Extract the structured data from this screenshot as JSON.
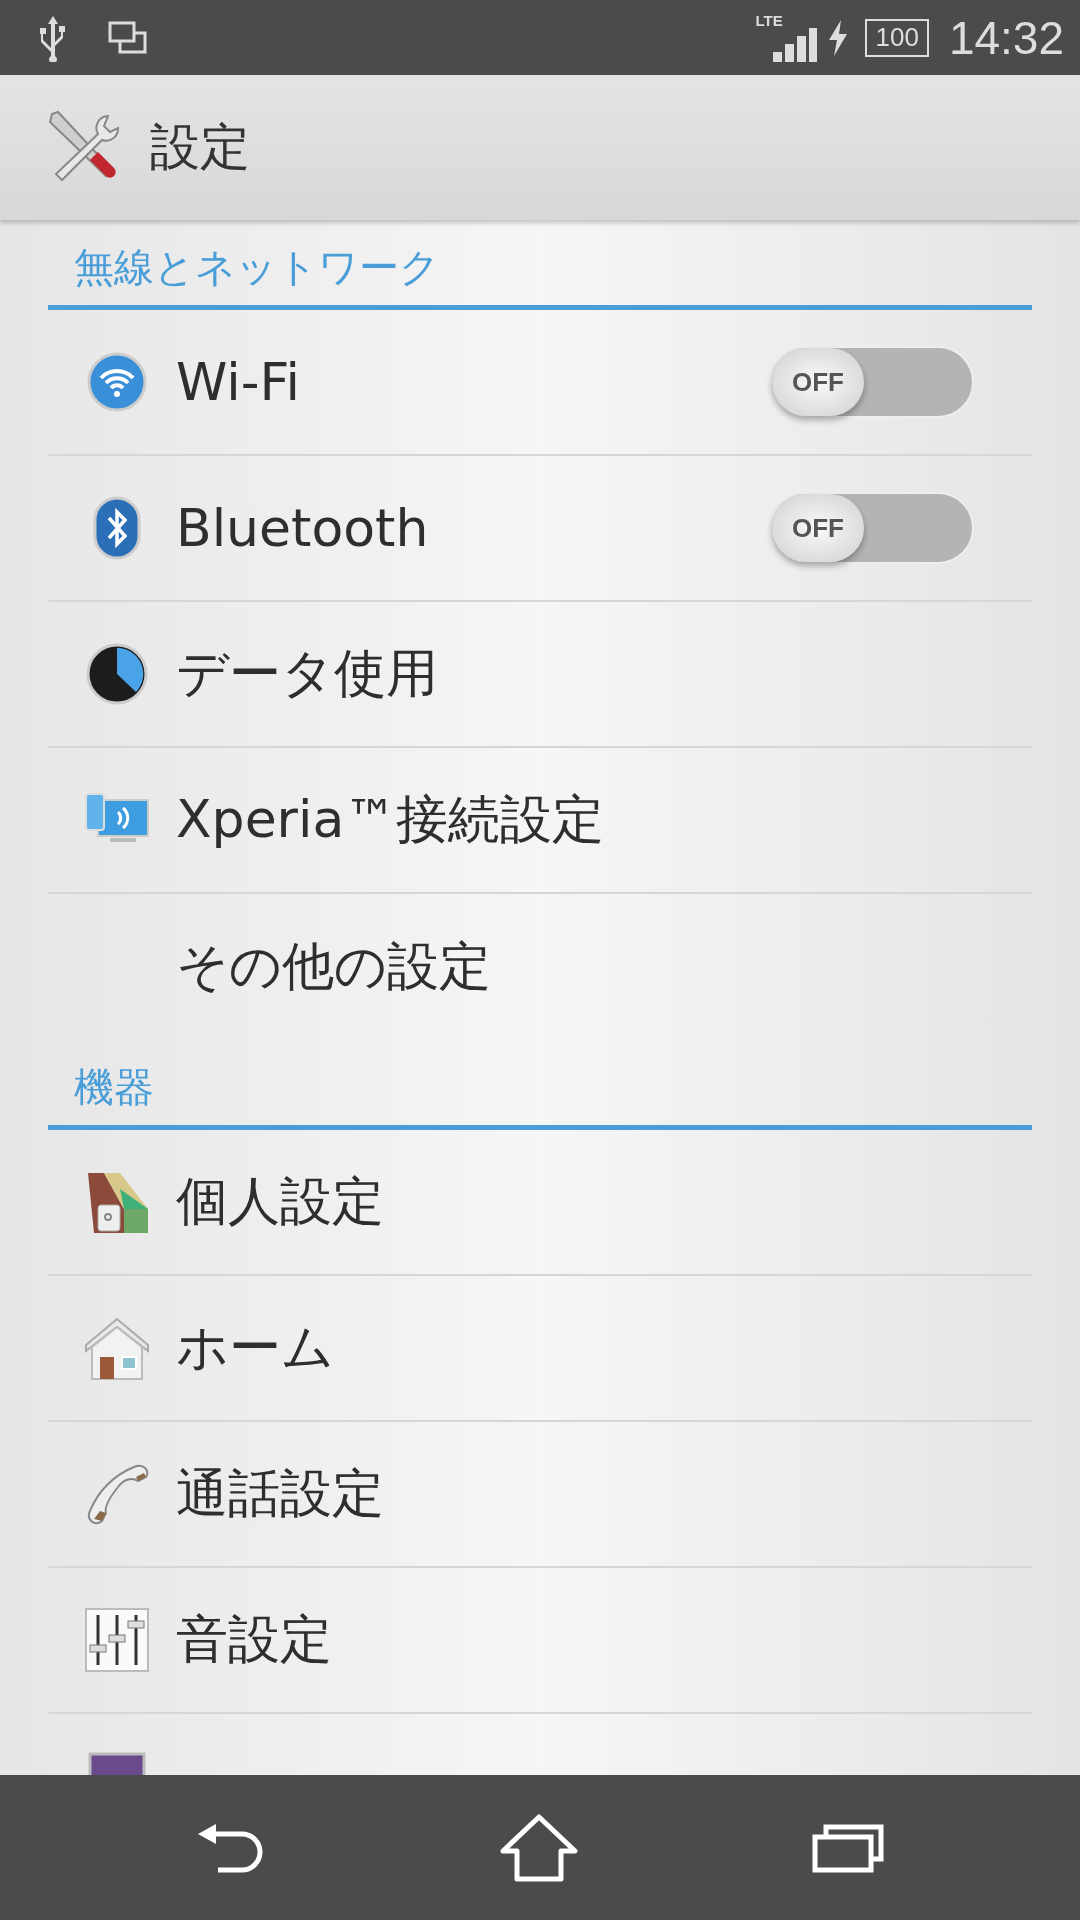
{
  "status_bar": {
    "network": "LTE",
    "battery": "100",
    "time": "14:32"
  },
  "action_bar": {
    "title": "設定"
  },
  "sections": [
    {
      "header": "無線とネットワーク",
      "items": [
        {
          "kind": "toggle",
          "label": "Wi-Fi",
          "on": false,
          "switch_text": "OFF"
        },
        {
          "kind": "toggle",
          "label": "Bluetooth",
          "on": false,
          "switch_text": "OFF"
        },
        {
          "kind": "plain",
          "label": "データ使用"
        },
        {
          "kind": "plain",
          "label": "Xperia™接続設定"
        },
        {
          "kind": "plain",
          "label": "その他の設定"
        }
      ]
    },
    {
      "header": "機器",
      "items": [
        {
          "kind": "plain",
          "label": "個人設定"
        },
        {
          "kind": "plain",
          "label": "ホーム"
        },
        {
          "kind": "plain",
          "label": "通話設定"
        },
        {
          "kind": "plain",
          "label": "音設定"
        },
        {
          "kind": "clipped"
        }
      ]
    }
  ]
}
